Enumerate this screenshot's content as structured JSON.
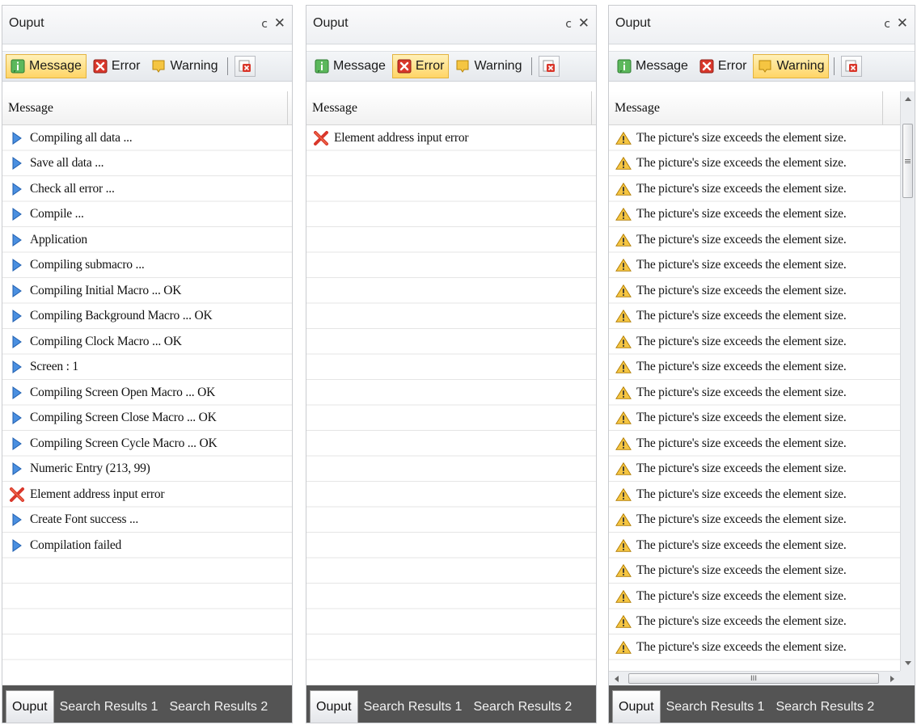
{
  "panels": [
    {
      "title": "Ouput",
      "active_filter": "message",
      "filters": {
        "message": "Message",
        "error": "Error",
        "warning": "Warning"
      },
      "column_header": "Message",
      "rows": [
        {
          "icon": "info-arrow-icon",
          "text": "Compiling all data ..."
        },
        {
          "icon": "info-arrow-icon",
          "text": "Save all data ..."
        },
        {
          "icon": "info-arrow-icon",
          "text": "Check all error ..."
        },
        {
          "icon": "info-arrow-icon",
          "text": "Compile ..."
        },
        {
          "icon": "info-arrow-icon",
          "text": "Application"
        },
        {
          "icon": "info-arrow-icon",
          "text": "Compiling submacro ..."
        },
        {
          "icon": "info-arrow-icon",
          "text": "Compiling Initial Macro ... OK"
        },
        {
          "icon": "info-arrow-icon",
          "text": "Compiling Background Macro ... OK"
        },
        {
          "icon": "info-arrow-icon",
          "text": "Compiling Clock Macro ... OK"
        },
        {
          "icon": "info-arrow-icon",
          "text": "Screen : 1"
        },
        {
          "icon": "info-arrow-icon",
          "text": "Compiling Screen Open Macro ... OK"
        },
        {
          "icon": "info-arrow-icon",
          "text": "Compiling Screen Close Macro ... OK"
        },
        {
          "icon": "info-arrow-icon",
          "text": "Compiling Screen Cycle Macro ... OK"
        },
        {
          "icon": "info-arrow-icon",
          "text": "Numeric Entry (213, 99)"
        },
        {
          "icon": "error-x-icon",
          "text": "Element address input error"
        },
        {
          "icon": "info-arrow-icon",
          "text": "Create Font success ..."
        },
        {
          "icon": "info-arrow-icon",
          "text": "Compilation failed"
        }
      ],
      "tabs": [
        "Ouput",
        "Search Results 1",
        "Search Results 2"
      ],
      "active_tab": 0
    },
    {
      "title": "Ouput",
      "active_filter": "error",
      "filters": {
        "message": "Message",
        "error": "Error",
        "warning": "Warning"
      },
      "column_header": "Message",
      "rows": [
        {
          "icon": "error-x-icon",
          "text": "Element address input error"
        }
      ],
      "tabs": [
        "Ouput",
        "Search Results 1",
        "Search Results 2"
      ],
      "active_tab": 0
    },
    {
      "title": "Ouput",
      "active_filter": "warning",
      "filters": {
        "message": "Message",
        "error": "Error",
        "warning": "Warning"
      },
      "column_header": "Message",
      "rows": [
        {
          "icon": "warning-triangle-icon",
          "text": "The picture's size exceeds the element size."
        },
        {
          "icon": "warning-triangle-icon",
          "text": "The picture's size exceeds the element size."
        },
        {
          "icon": "warning-triangle-icon",
          "text": "The picture's size exceeds the element size."
        },
        {
          "icon": "warning-triangle-icon",
          "text": "The picture's size exceeds the element size."
        },
        {
          "icon": "warning-triangle-icon",
          "text": "The picture's size exceeds the element size."
        },
        {
          "icon": "warning-triangle-icon",
          "text": "The picture's size exceeds the element size."
        },
        {
          "icon": "warning-triangle-icon",
          "text": "The picture's size exceeds the element size."
        },
        {
          "icon": "warning-triangle-icon",
          "text": "The picture's size exceeds the element size."
        },
        {
          "icon": "warning-triangle-icon",
          "text": "The picture's size exceeds the element size."
        },
        {
          "icon": "warning-triangle-icon",
          "text": "The picture's size exceeds the element size."
        },
        {
          "icon": "warning-triangle-icon",
          "text": "The picture's size exceeds the element size."
        },
        {
          "icon": "warning-triangle-icon",
          "text": "The picture's size exceeds the element size."
        },
        {
          "icon": "warning-triangle-icon",
          "text": "The picture's size exceeds the element size."
        },
        {
          "icon": "warning-triangle-icon",
          "text": "The picture's size exceeds the element size."
        },
        {
          "icon": "warning-triangle-icon",
          "text": "The picture's size exceeds the element size."
        },
        {
          "icon": "warning-triangle-icon",
          "text": "The picture's size exceeds the element size."
        },
        {
          "icon": "warning-triangle-icon",
          "text": "The picture's size exceeds the element size."
        },
        {
          "icon": "warning-triangle-icon",
          "text": "The picture's size exceeds the element size."
        },
        {
          "icon": "warning-triangle-icon",
          "text": "The picture's size exceeds the element size."
        },
        {
          "icon": "warning-triangle-icon",
          "text": "The picture's size exceeds the element size."
        },
        {
          "icon": "warning-triangle-icon",
          "text": "The picture's size exceeds the element size."
        }
      ],
      "tabs": [
        "Ouput",
        "Search Results 1",
        "Search Results 2"
      ],
      "active_tab": 0,
      "scrollbars": true
    }
  ],
  "glyphs": {
    "pin": "ᴄ",
    "close": "✕",
    "hscroll_grip": "III",
    "vscroll_grip": "≡"
  },
  "colors": {
    "active_filter_bg": "#ffd566",
    "info_arrow": "#3a7bd5",
    "error_x": "#d9372b",
    "warning_fill": "#f5c542",
    "message_icon_green": "#4caf50",
    "tab_bar_bg": "#545454"
  }
}
